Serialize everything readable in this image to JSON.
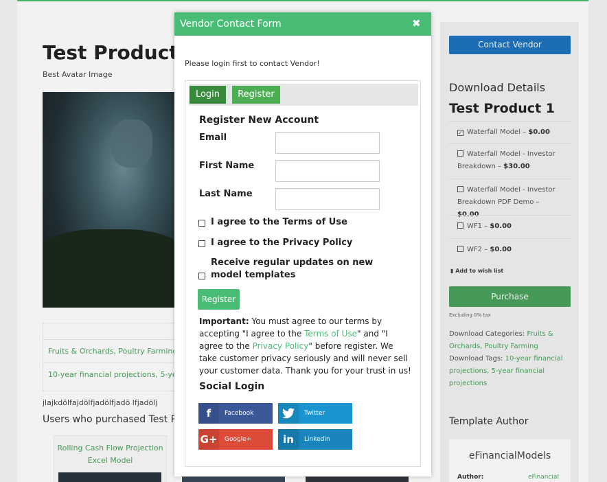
{
  "background": {
    "product_title": "Test Product 1",
    "avatar_caption": "Best Avatar Image",
    "categories_link": "Fruits & Orchards, Poultry Farming",
    "tags_link": "10-year financial projections, 5-year fi",
    "misc_text": "jlajkdölfajdölfjadölfjadö lfjadölj",
    "users_heading": "Users who purchased Test Pro",
    "card_title": "Rolling Cash Flow Projection Excel Model"
  },
  "sidebar": {
    "contact_button": "Contact Vendor",
    "download_details_title": "Download Details",
    "product_name": "Test Product 1",
    "items": [
      {
        "label": "Waterfall Model – ",
        "price": "$0.00",
        "checked": true
      },
      {
        "label": "Waterfall Model - Investor Breakdown – ",
        "price": "$30.00",
        "checked": false
      },
      {
        "label": "Waterfall Model - Investor Breakdown PDF Demo – ",
        "price": "$0.00",
        "checked": false
      },
      {
        "label": "WF1 – ",
        "price": "$0.00",
        "checked": false
      },
      {
        "label": "WF2 – ",
        "price": "$0.00",
        "checked": false
      }
    ],
    "wish_list": "Add to wish list",
    "purchase_button": "Purchase",
    "tax_note": "Excluding 0% tax",
    "categories_label": "Download Categories: ",
    "categories_value": "Fruits & Orchards, Poultry Farming",
    "tags_label": "Download Tags: ",
    "tags_value": "10-year financial projections, 5-year financial projections",
    "author_title": "Template Author",
    "author_name": "eFinancialModels",
    "author_label": "Author:",
    "author_value": "eFinancial"
  },
  "modal": {
    "title": "Vendor Contact Form",
    "close_glyph": "✖",
    "login_note": "Please login first to contact Vendor!",
    "tabs": {
      "login": "Login",
      "register": "Register"
    },
    "form": {
      "heading": "Register New Account",
      "email_label": "Email",
      "first_name_label": "First Name",
      "last_name_label": "Last Name",
      "terms_label": "I agree to the Terms of Use",
      "privacy_label": "I agree to the Privacy Policy",
      "updates_label": "Receive regular updates on new model templates",
      "register_button": "Register"
    },
    "important": {
      "bold": "Important:",
      "text1": " You must agree to our terms by accepting \"I agree to the ",
      "terms_link": "Terms of Use",
      "text2": "\" and \"I agree to the ",
      "privacy_link": "Privacy Policy",
      "text3": "\" before register. We take customer privacy seriously and will never sell your customer data. Thank you for your trust in us!"
    },
    "social": {
      "title": "Social Login",
      "facebook": "Facebook",
      "twitter": "Twitter",
      "google": "Google+",
      "linkedin": "Linkedin"
    }
  },
  "colors": {
    "modal_header": "#49bd76",
    "contact_button": "#1e73be",
    "purchase_button": "#49a35d",
    "facebook": "#3b5999",
    "twitter": "#1b95cf",
    "google": "#dd4b39",
    "linkedin": "#1a84bc"
  }
}
